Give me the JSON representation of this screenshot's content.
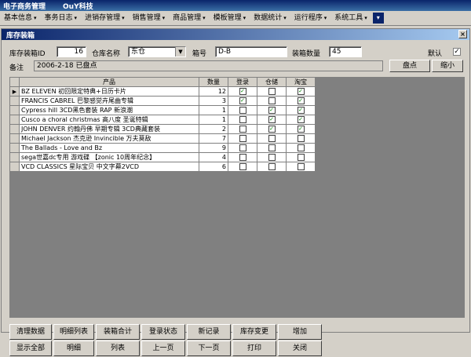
{
  "app": {
    "title": "电子商务管理",
    "company": "OuY科技"
  },
  "menu": [
    {
      "label": "基本信息"
    },
    {
      "label": "事务日志"
    },
    {
      "label": "进销存管理"
    },
    {
      "label": "销售管理"
    },
    {
      "label": "商品管理"
    },
    {
      "label": "模板管理"
    },
    {
      "label": "数据统计"
    },
    {
      "label": "运行程序"
    },
    {
      "label": "系统工具"
    }
  ],
  "window": {
    "title": "库存装箱",
    "close": "×"
  },
  "form": {
    "box_id_label": "库存装箱ID",
    "box_id": "16",
    "warehouse_label": "仓库名称",
    "warehouse": "东仓",
    "box_no_label": "箱号",
    "box_no": "D-B",
    "qty_label": "装箱数量",
    "qty": "45",
    "default_label": "默认",
    "default_checked": "✓",
    "note_label": "备注",
    "note": "2006-2-18 已盘点",
    "check_btn": "盘点",
    "shrink_btn": "缩小"
  },
  "grid": {
    "headers": {
      "product": "产品",
      "qty": "数量",
      "login": "登录",
      "warehouse": "仓储",
      "taobao": "淘宝"
    },
    "pointer": "▶",
    "rows": [
      {
        "product": "BZ ELEVEN 初回限定特典+日历卡片",
        "qty": "12",
        "login": "✓",
        "warehouse": "",
        "taobao": "✓"
      },
      {
        "product": "FRANCIS CABREL 巴黎感觉卉尾曲专辑",
        "qty": "3",
        "login": "✓",
        "warehouse": "",
        "taobao": "✓"
      },
      {
        "product": "Cypress hill 3CD黑色套装 RAP 新浪潮",
        "qty": "1",
        "login": "",
        "warehouse": "✓",
        "taobao": "✓"
      },
      {
        "product": "Cusco a choral christmas 高八度 圣诞特辑",
        "qty": "1",
        "login": "",
        "warehouse": "✓",
        "taobao": "✓"
      },
      {
        "product": "JOHN DENVER 约翰丹佛 早期专辑 3CD典藏套装",
        "qty": "2",
        "login": "",
        "warehouse": "✓",
        "taobao": "✓"
      },
      {
        "product": "Michael Jackson 杰克逊 Invincible 万夫莫敌",
        "qty": "7",
        "login": "",
        "warehouse": "",
        "taobao": ""
      },
      {
        "product": "The Ballads - Love and Bz",
        "qty": "9",
        "login": "",
        "warehouse": "",
        "taobao": ""
      },
      {
        "product": "sega世嘉dc专用 游戏碟 【zonic 10周年纪念】",
        "qty": "4",
        "login": "",
        "warehouse": "",
        "taobao": ""
      },
      {
        "product": "VCD CLASSICS 星际宝贝 中文字幕2VCD",
        "qty": "6",
        "login": "",
        "warehouse": "",
        "taobao": ""
      }
    ]
  },
  "buttons": {
    "row1": [
      "清理数据",
      "明细列表",
      "装箱合计",
      "登录状态",
      "新记录",
      "库存变更",
      "增加"
    ],
    "row2": [
      "显示全部",
      "明细",
      "列表",
      "上一页",
      "下一页",
      "打印",
      "关闭"
    ]
  }
}
